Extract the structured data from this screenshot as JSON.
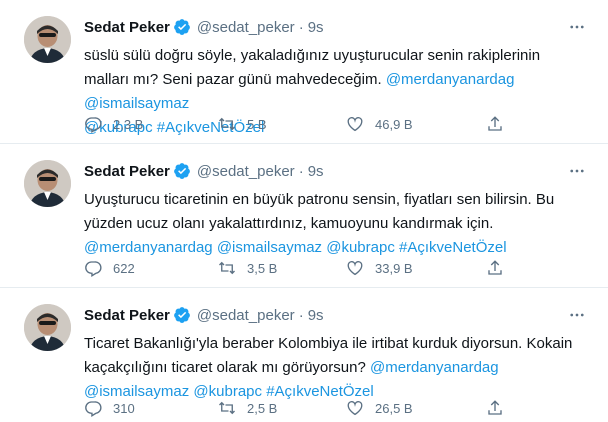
{
  "tweets": [
    {
      "name": "Sedat Peker",
      "handle": "@sedat_peker",
      "separator": "·",
      "time": "9s",
      "text_parts": [
        {
          "text": "süslü sülü doğru söyle, yakaladığınız uyuşturucular senin rakiplerinin malları mı? Seni pazar günü mahvedeceğim. ",
          "link": false
        },
        {
          "text": "@merdanyanardag",
          "link": true
        },
        {
          "text": " ",
          "link": false
        },
        {
          "text": "@ismailsaymaz",
          "link": true
        },
        {
          "text": " ",
          "link": false
        },
        {
          "text": "@kubrapc",
          "link": true
        },
        {
          "text": " ",
          "link": false
        },
        {
          "text": "#AçıkveNetÖzel",
          "link": true
        }
      ],
      "reply_count": "2,3 B",
      "retweet_count": "5 B",
      "like_count": "46,9 B"
    },
    {
      "name": "Sedat Peker",
      "handle": "@sedat_peker",
      "separator": "·",
      "time": "9s",
      "text_parts": [
        {
          "text": "Uyuşturucu ticaretinin en büyük patronu sensin, fiyatları sen bilirsin. Bu yüzden ucuz olanı yakalattırdınız, kamuoyunu kandırmak için. ",
          "link": false
        },
        {
          "text": "@merdanyanardag",
          "link": true
        },
        {
          "text": " ",
          "link": false
        },
        {
          "text": "@ismailsaymaz",
          "link": true
        },
        {
          "text": " ",
          "link": false
        },
        {
          "text": "@kubrapc",
          "link": true
        },
        {
          "text": " ",
          "link": false
        },
        {
          "text": "#AçıkveNetÖzel",
          "link": true
        }
      ],
      "reply_count": "622",
      "retweet_count": "3,5 B",
      "like_count": "33,9 B"
    },
    {
      "name": "Sedat Peker",
      "handle": "@sedat_peker",
      "separator": "·",
      "time": "9s",
      "text_parts": [
        {
          "text": "Ticaret Bakanlığı'yla beraber Kolombiya ile irtibat kurduk diyorsun. Kokain kaçakçılığını ticaret olarak mı görüyorsun? ",
          "link": false
        },
        {
          "text": "@merdanyanardag",
          "link": true
        },
        {
          "text": " ",
          "link": false
        },
        {
          "text": "@ismailsaymaz",
          "link": true
        },
        {
          "text": " ",
          "link": false
        },
        {
          "text": "@kubrapc",
          "link": true
        },
        {
          "text": " ",
          "link": false
        },
        {
          "text": "#AçıkveNetÖzel",
          "link": true
        }
      ],
      "reply_count": "310",
      "retweet_count": "2,5 B",
      "like_count": "26,5 B"
    }
  ],
  "icons": {
    "verified": "verified-badge-icon",
    "more": "more-options-icon",
    "reply": "reply-icon",
    "retweet": "retweet-icon",
    "like": "like-icon",
    "share": "share-icon"
  },
  "colors": {
    "link": "#1b95e0",
    "muted": "#5b7083",
    "verified": "#1da1f2",
    "divider": "#e6ecf0"
  }
}
